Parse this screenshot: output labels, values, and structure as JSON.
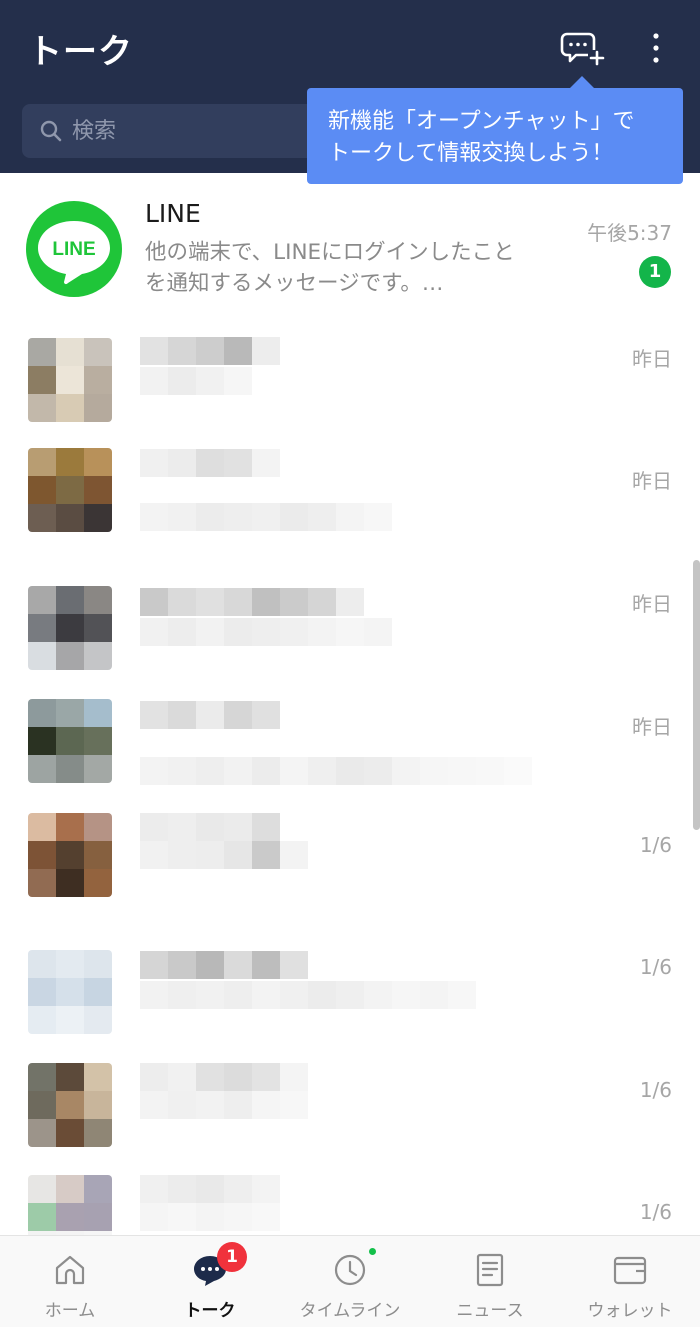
{
  "header": {
    "title": "トーク",
    "search_placeholder": "検索"
  },
  "tooltip": {
    "line1": "新機能「オープンチャット」で",
    "line2": "トークして情報交換しよう！"
  },
  "chats": [
    {
      "name": "LINE",
      "avatar_text": "LINE",
      "preview_line1": "他の端末で、LINEにログインしたこと",
      "preview_line2": "を通知するメッセージです。…",
      "time": "午後5:37",
      "unread": "1"
    },
    {
      "time": "昨日"
    },
    {
      "time": "昨日"
    },
    {
      "time": "昨日"
    },
    {
      "time": "昨日"
    },
    {
      "time": "1/6"
    },
    {
      "time": "1/6"
    },
    {
      "time": "1/6"
    },
    {
      "time": "1/6"
    }
  ],
  "tabs": [
    {
      "label": "ホーム",
      "icon": "home-icon"
    },
    {
      "label": "トーク",
      "icon": "talk-icon",
      "badge": "1",
      "active": true
    },
    {
      "label": "タイムライン",
      "icon": "clock-icon"
    },
    {
      "label": "ニュース",
      "icon": "news-icon"
    },
    {
      "label": "ウォレット",
      "icon": "wallet-icon"
    }
  ],
  "colors": {
    "header_bg": "#242f4b",
    "tooltip_bg": "#5b8cf4",
    "line_green": "#1fc539",
    "unread_green": "#13b54a",
    "badge_red": "#f0323c"
  }
}
